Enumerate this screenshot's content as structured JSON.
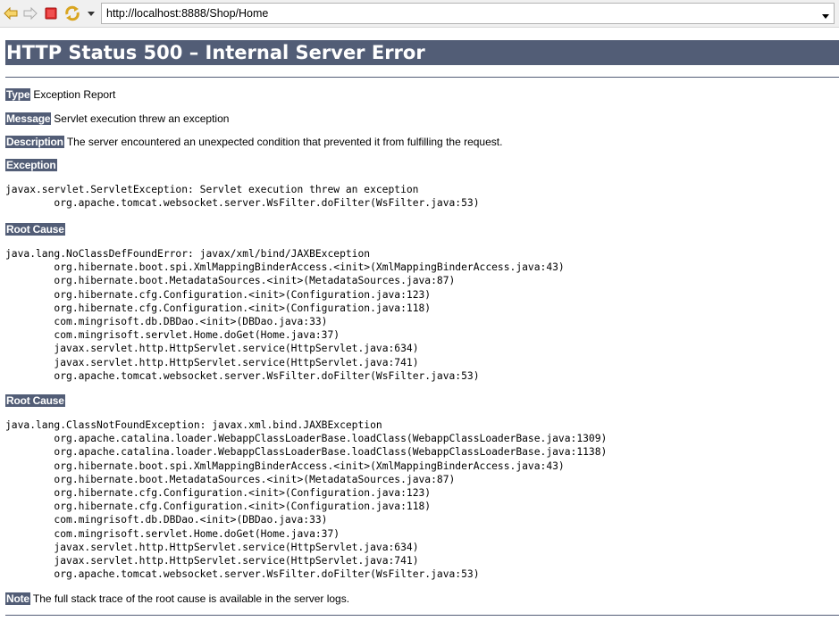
{
  "browser": {
    "url": "http://localhost:8888/Shop/Home",
    "icons": {
      "back": "back-arrow-icon",
      "forward": "forward-arrow-icon",
      "stop": "stop-icon",
      "refresh": "refresh-icon",
      "menu": "chevron-down-icon",
      "url_dropdown": "chevron-down-icon"
    }
  },
  "page": {
    "title": "HTTP Status 500 – Internal Server Error",
    "type_label": "Type",
    "type_value": "Exception Report",
    "message_label": "Message",
    "message_value": "Servlet execution threw an exception",
    "description_label": "Description",
    "description_value": "The server encountered an unexpected condition that prevented it from fulfilling the request.",
    "exception_label": "Exception",
    "exception_trace": "javax.servlet.ServletException: Servlet execution threw an exception\n\torg.apache.tomcat.websocket.server.WsFilter.doFilter(WsFilter.java:53)",
    "root_cause_label_1": "Root Cause",
    "root_cause_trace_1": "java.lang.NoClassDefFoundError: javax/xml/bind/JAXBException\n\torg.hibernate.boot.spi.XmlMappingBinderAccess.<init>(XmlMappingBinderAccess.java:43)\n\torg.hibernate.boot.MetadataSources.<init>(MetadataSources.java:87)\n\torg.hibernate.cfg.Configuration.<init>(Configuration.java:123)\n\torg.hibernate.cfg.Configuration.<init>(Configuration.java:118)\n\tcom.mingrisoft.db.DBDao.<init>(DBDao.java:33)\n\tcom.mingrisoft.servlet.Home.doGet(Home.java:37)\n\tjavax.servlet.http.HttpServlet.service(HttpServlet.java:634)\n\tjavax.servlet.http.HttpServlet.service(HttpServlet.java:741)\n\torg.apache.tomcat.websocket.server.WsFilter.doFilter(WsFilter.java:53)",
    "root_cause_label_2": "Root Cause",
    "root_cause_trace_2": "java.lang.ClassNotFoundException: javax.xml.bind.JAXBException\n\torg.apache.catalina.loader.WebappClassLoaderBase.loadClass(WebappClassLoaderBase.java:1309)\n\torg.apache.catalina.loader.WebappClassLoaderBase.loadClass(WebappClassLoaderBase.java:1138)\n\torg.hibernate.boot.spi.XmlMappingBinderAccess.<init>(XmlMappingBinderAccess.java:43)\n\torg.hibernate.boot.MetadataSources.<init>(MetadataSources.java:87)\n\torg.hibernate.cfg.Configuration.<init>(Configuration.java:123)\n\torg.hibernate.cfg.Configuration.<init>(Configuration.java:118)\n\tcom.mingrisoft.db.DBDao.<init>(DBDao.java:33)\n\tcom.mingrisoft.servlet.Home.doGet(Home.java:37)\n\tjavax.servlet.http.HttpServlet.service(HttpServlet.java:634)\n\tjavax.servlet.http.HttpServlet.service(HttpServlet.java:741)\n\torg.apache.tomcat.websocket.server.WsFilter.doFilter(WsFilter.java:53)",
    "note_label": "Note",
    "note_value": "The full stack trace of the root cause is available in the server logs."
  },
  "colors": {
    "header_bg": "#525d76",
    "header_text": "#ffffff",
    "toolbar_bg": "#f0f0f0"
  }
}
